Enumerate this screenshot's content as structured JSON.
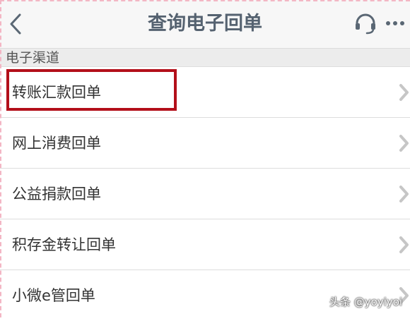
{
  "header": {
    "title": "查询电子回单",
    "back_icon": "chevron-left-icon",
    "support_icon": "headset-icon",
    "more_icon": "more-horizontal-icon"
  },
  "section": {
    "label": "电子渠道"
  },
  "items": [
    {
      "label": "转账汇款回单"
    },
    {
      "label": "网上消费回单"
    },
    {
      "label": "公益捐款回单"
    },
    {
      "label": "积存金转让回单"
    },
    {
      "label": "小微e管回单"
    }
  ],
  "watermark": {
    "text": "头条 @yoyiyoi"
  },
  "colors": {
    "title": "#556270",
    "highlight": "#b30f1a",
    "icon": "#5a6774",
    "chevron": "#c6c6c6"
  }
}
